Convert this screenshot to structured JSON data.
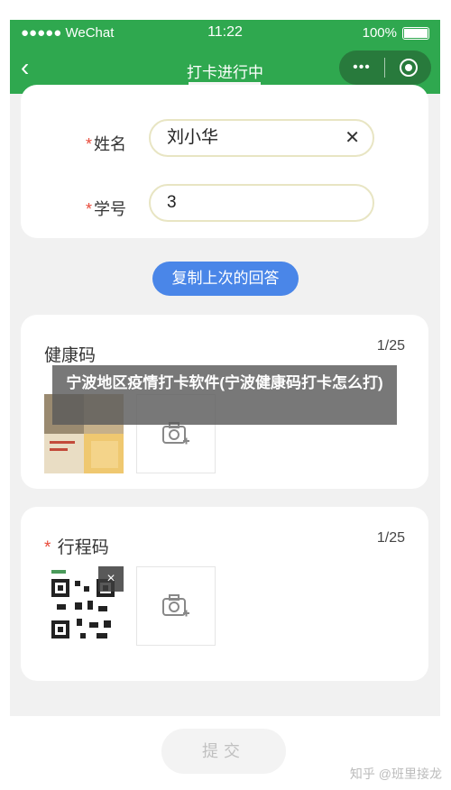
{
  "status_bar": {
    "carrier": "●●●●● WeChat",
    "time": "11:22",
    "battery": "100%"
  },
  "nav": {
    "back": "‹",
    "title": "打卡进行中",
    "more": "•••"
  },
  "form": {
    "name_label": "姓名",
    "name_value": "刘小华",
    "clear": "✕",
    "id_label": "学号",
    "id_value": "3",
    "required_mark": "*"
  },
  "copy_button": "复制上次的回答",
  "health_code": {
    "title": "健康码",
    "count": "1/25"
  },
  "itinerary_code": {
    "title": "行程码",
    "count": "1/25",
    "remove": "×"
  },
  "submit": "提交",
  "overlay_caption": "宁波地区疫情打卡软件(宁波健康码打卡怎么打)",
  "watermark": "知乎 @班里接龙",
  "colors": {
    "header": "#2fa84f",
    "capsule": "#287a3c",
    "button": "#4a86e8",
    "required": "#e84a3a"
  },
  "icons": [
    "chevron-left-icon",
    "more-dots-icon",
    "close-target-icon",
    "clear-icon",
    "camera-add-icon"
  ]
}
